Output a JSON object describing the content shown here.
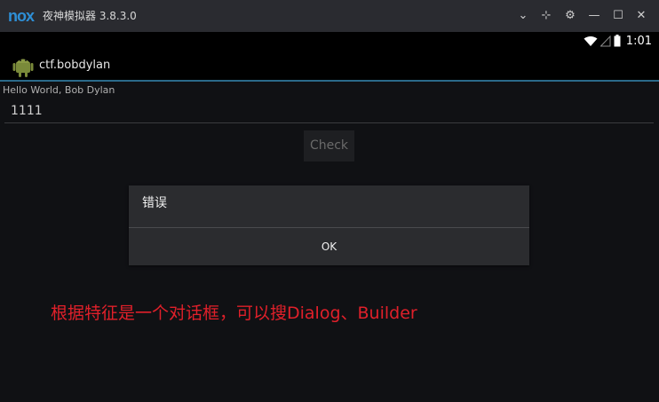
{
  "window": {
    "logo_text": "nox",
    "title": "夜神模拟器 3.8.3.0",
    "controls": {
      "dropdown": "⌄",
      "pin": "⊹",
      "settings": "⚙",
      "minimize": "—",
      "maximize": "☐",
      "close": "✕"
    }
  },
  "statusbar": {
    "time": "1:01"
  },
  "actionbar": {
    "app_name": "ctf.bobdylan"
  },
  "main": {
    "hello_text": "Hello World, Bob Dylan",
    "input_value": "1111",
    "check_label": "Check"
  },
  "dialog": {
    "title": "错误",
    "ok_label": "OK"
  },
  "annotation": "根据特征是一个对话框，可以搜Dialog、Builder",
  "colors": {
    "accent": "#2e8fd6",
    "annotation": "#e0202a",
    "divider": "#2b6a8a"
  }
}
